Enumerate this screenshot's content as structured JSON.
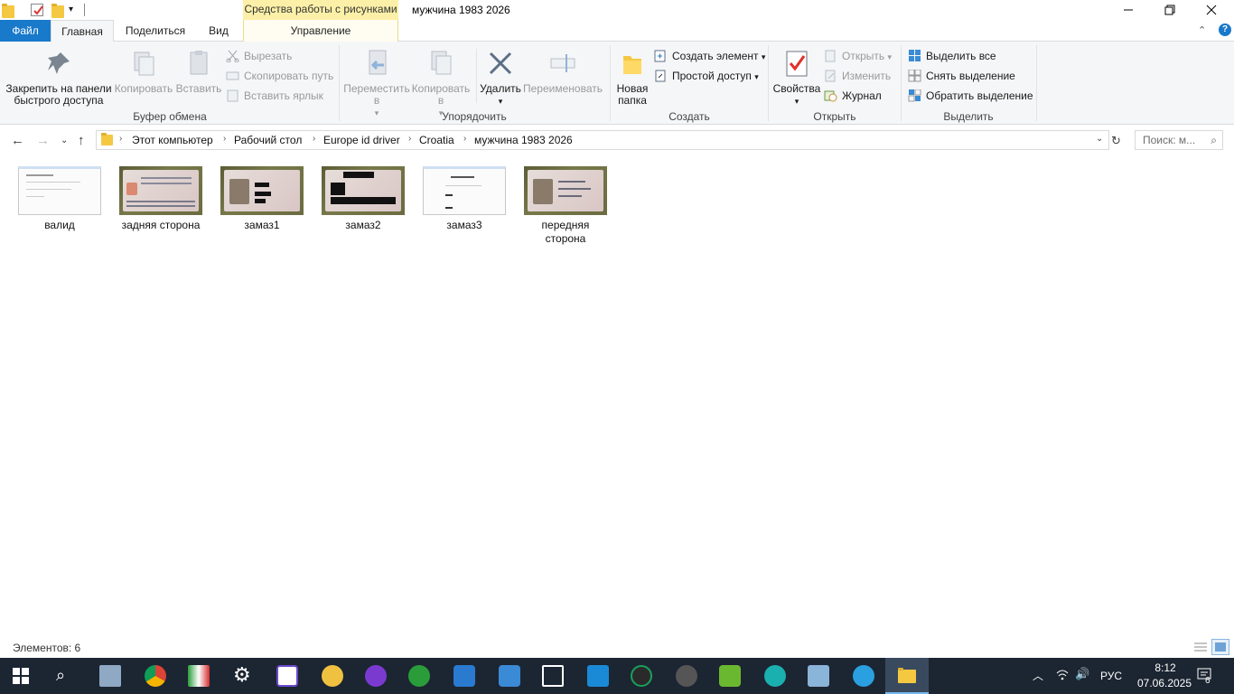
{
  "window": {
    "title": "мужчина 1983 2026",
    "context_tab_header": "Средства работы с рисунками"
  },
  "tabs": [
    "Файл",
    "Главная",
    "Поделиться",
    "Вид",
    "Управление"
  ],
  "ribbon": {
    "clipboard": {
      "pin": "Закрепить на панели быстрого доступа",
      "copy": "Копировать",
      "paste": "Вставить",
      "cut": "Вырезать",
      "copy_path": "Скопировать путь",
      "paste_shortcut": "Вставить ярлык",
      "label": "Буфер обмена"
    },
    "organize": {
      "move": "Переместить в",
      "copy_to": "Копировать в",
      "delete": "Удалить",
      "rename": "Переименовать",
      "label": "Упорядочить"
    },
    "create": {
      "new_folder": "Новая папка",
      "new_item": "Создать элемент",
      "easy_access": "Простой доступ",
      "label": "Создать"
    },
    "open": {
      "properties": "Свойства",
      "open": "Открыть",
      "edit": "Изменить",
      "history": "Журнал",
      "label": "Открыть"
    },
    "select": {
      "select_all": "Выделить все",
      "select_none": "Снять выделение",
      "invert": "Обратить выделение",
      "label": "Выделить"
    }
  },
  "address": {
    "crumbs": [
      "Этот компьютер",
      "Рабочий стол",
      "Europe id driver",
      "Croatia",
      "мужчина 1983 2026"
    ],
    "search_placeholder": "Поиск: м..."
  },
  "files": [
    {
      "name": "валид",
      "kind": "doc"
    },
    {
      "name": "задняя сторона",
      "kind": "card-back"
    },
    {
      "name": "замаз1",
      "kind": "card-front-redacted"
    },
    {
      "name": "замаз2",
      "kind": "card-heavily-redacted"
    },
    {
      "name": "замаз3",
      "kind": "doc"
    },
    {
      "name": "передняя сторона",
      "kind": "card-front"
    }
  ],
  "status": {
    "count_text": "Элементов: 6"
  },
  "tray": {
    "language": "РУС",
    "time": "8:12",
    "date": "07.06.2025",
    "notifications": "6"
  },
  "colors": {
    "accent": "#1979ca",
    "context_tab": "#fcf0a8",
    "taskbar": "#1c2532"
  }
}
